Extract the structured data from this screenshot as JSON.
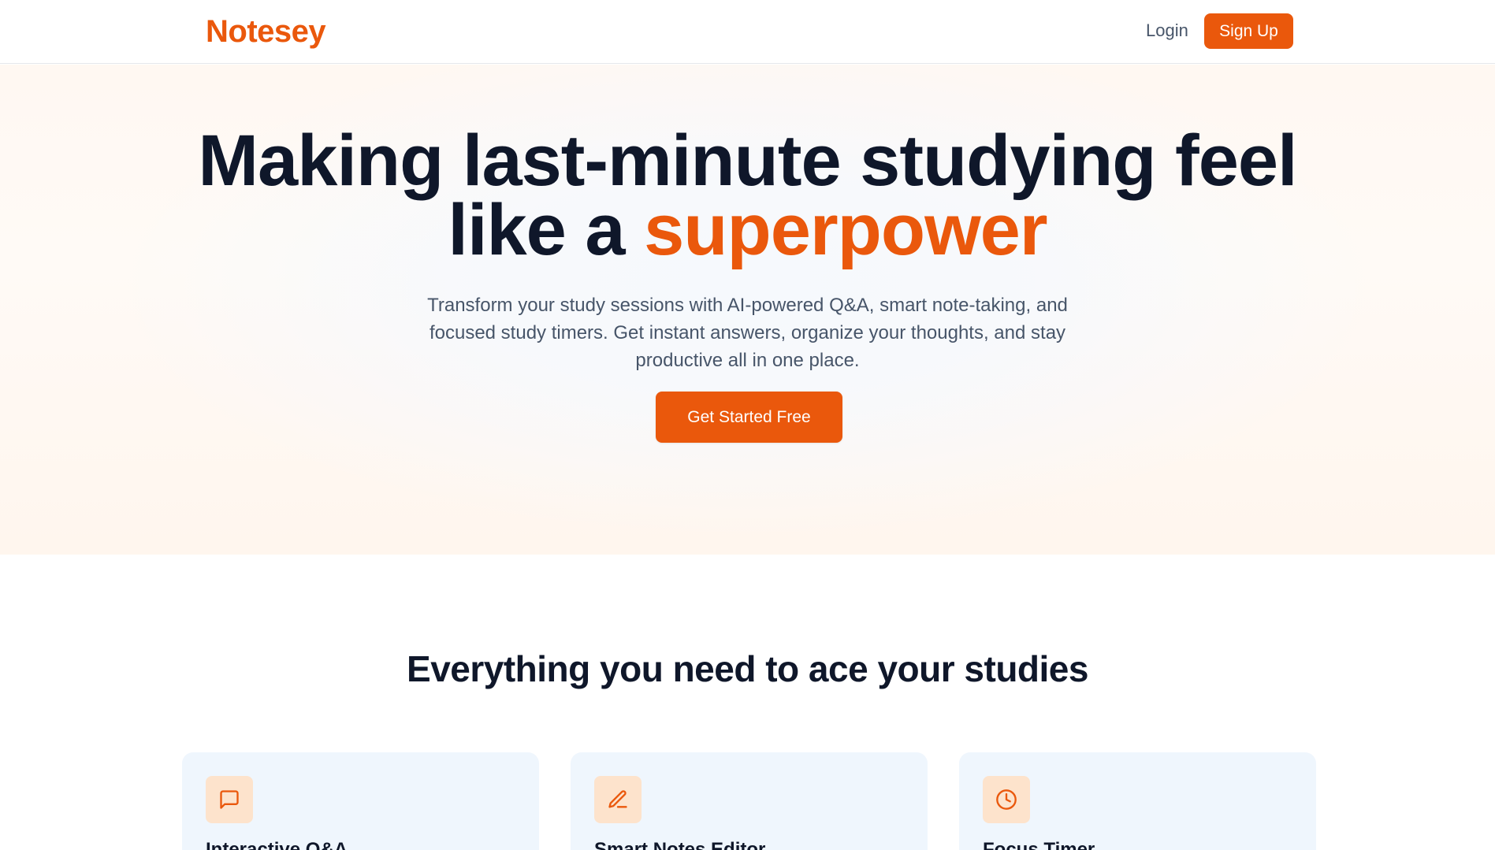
{
  "header": {
    "brand": "Notesey",
    "login_label": "Login",
    "signup_label": "Sign Up"
  },
  "hero": {
    "title_line1": "Making last-minute studying feel",
    "title_line2_prefix": "like a ",
    "title_line2_accent": "superpower",
    "subtitle": "Transform your study sessions with AI-powered Q&A, smart note-taking, and focused study timers. Get instant answers, organize your thoughts, and stay productive all in one place.",
    "cta_label": "Get Started Free"
  },
  "features": {
    "heading": "Everything you need to ace your studies",
    "cards": [
      {
        "icon": "chat-bubble-icon",
        "title": "Interactive Q&A"
      },
      {
        "icon": "pencil-icon",
        "title": "Smart Notes Editor"
      },
      {
        "icon": "clock-icon",
        "title": "Focus Timer"
      }
    ]
  },
  "colors": {
    "accent": "#ea580c",
    "text_dark": "#0f172a",
    "text_muted": "#475569",
    "card_bg": "#eff6fd",
    "icon_bg": "#fde3cc"
  }
}
